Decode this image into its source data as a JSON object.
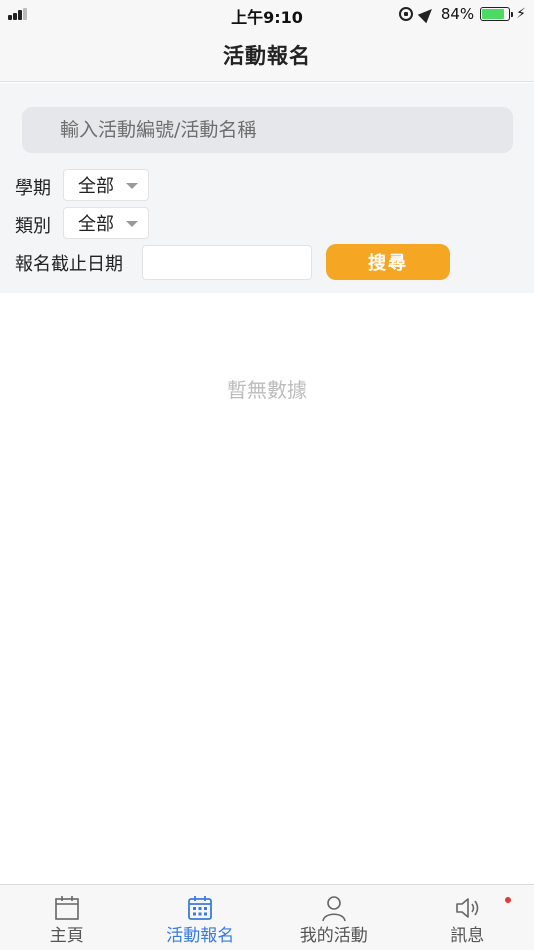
{
  "status_bar": {
    "time": "上午9:10",
    "battery_percent": "84%",
    "battery_level": 0.84,
    "icons": [
      "signal-icon",
      "rotation-lock-icon",
      "location-icon",
      "battery-icon",
      "charging-icon"
    ]
  },
  "header": {
    "title": "活動報名"
  },
  "filters": {
    "search_placeholder": "輸入活動編號/活動名稱",
    "semester_label": "學期",
    "semester_value": "全部",
    "category_label": "類別",
    "category_value": "全部",
    "deadline_label": "報名截止日期",
    "deadline_value": "",
    "search_button": "搜尋"
  },
  "empty_state": "暫無數據",
  "tabs": [
    {
      "label": "主頁",
      "icon": "calendar-icon",
      "active": false
    },
    {
      "label": "活動報名",
      "icon": "calendar-grid-icon",
      "active": true
    },
    {
      "label": "我的活動",
      "icon": "person-icon",
      "active": false
    },
    {
      "label": "訊息",
      "icon": "speaker-icon",
      "active": false
    }
  ],
  "colors": {
    "accent": "#3a7be0",
    "button": "#f5a623",
    "badge": "#e53935",
    "battery": "#4cd964"
  }
}
